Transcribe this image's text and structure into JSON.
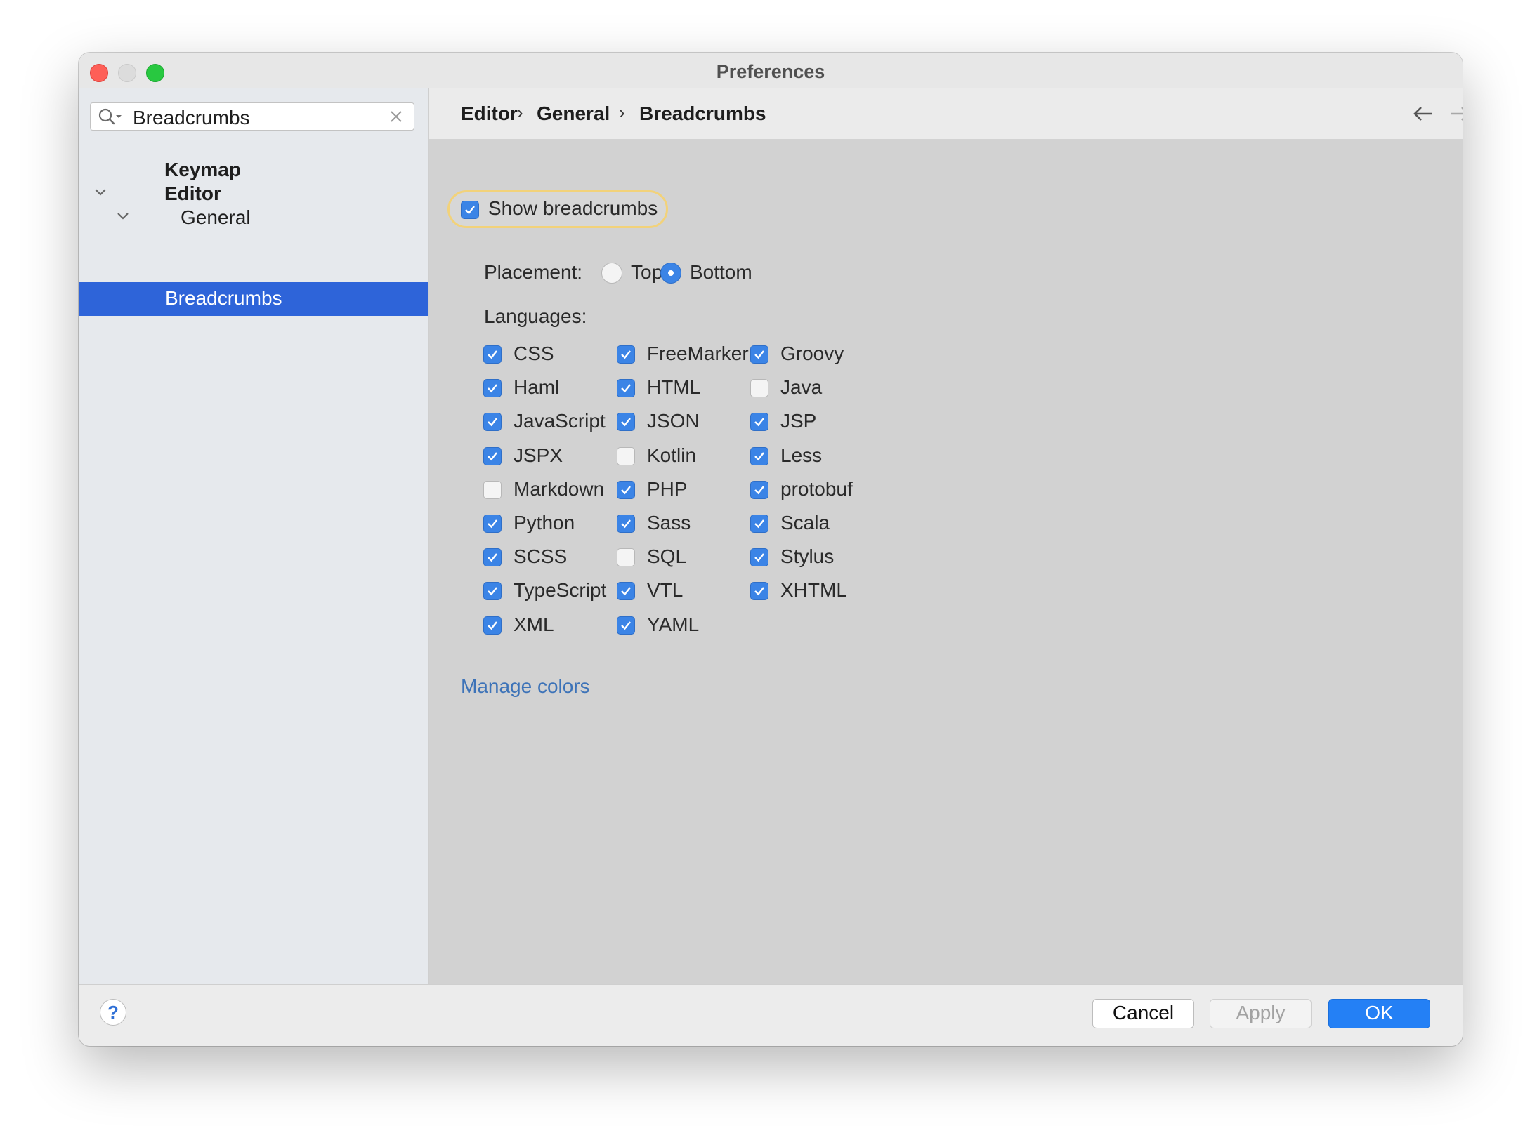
{
  "window": {
    "title": "Preferences"
  },
  "sidebar": {
    "search": {
      "value": "Breadcrumbs",
      "placeholder": ""
    },
    "items": [
      {
        "label": "Keymap"
      },
      {
        "label": "Editor"
      },
      {
        "label": "General"
      },
      {
        "label": "Breadcrumbs",
        "selected": true
      }
    ]
  },
  "breadcrumb": [
    "Editor",
    "General",
    "Breadcrumbs"
  ],
  "settings": {
    "show_breadcrumbs": {
      "label": "Show breadcrumbs",
      "checked": true
    },
    "placement": {
      "label": "Placement:",
      "options": [
        {
          "label": "Top",
          "selected": false
        },
        {
          "label": "Bottom",
          "selected": true
        }
      ]
    },
    "languages_label": "Languages:",
    "languages": [
      {
        "name": "CSS",
        "checked": true
      },
      {
        "name": "FreeMarker",
        "checked": true
      },
      {
        "name": "Groovy",
        "checked": true
      },
      {
        "name": "Haml",
        "checked": true
      },
      {
        "name": "HTML",
        "checked": true
      },
      {
        "name": "Java",
        "checked": false
      },
      {
        "name": "JavaScript",
        "checked": true
      },
      {
        "name": "JSON",
        "checked": true
      },
      {
        "name": "JSP",
        "checked": true
      },
      {
        "name": "JSPX",
        "checked": true
      },
      {
        "name": "Kotlin",
        "checked": false
      },
      {
        "name": "Less",
        "checked": true
      },
      {
        "name": "Markdown",
        "checked": false
      },
      {
        "name": "PHP",
        "checked": true
      },
      {
        "name": "protobuf",
        "checked": true
      },
      {
        "name": "Python",
        "checked": true
      },
      {
        "name": "Sass",
        "checked": true
      },
      {
        "name": "Scala",
        "checked": true
      },
      {
        "name": "SCSS",
        "checked": true
      },
      {
        "name": "SQL",
        "checked": false
      },
      {
        "name": "Stylus",
        "checked": true
      },
      {
        "name": "TypeScript",
        "checked": true
      },
      {
        "name": "VTL",
        "checked": true
      },
      {
        "name": "XHTML",
        "checked": true
      },
      {
        "name": "XML",
        "checked": true
      },
      {
        "name": "YAML",
        "checked": true
      }
    ],
    "manage_colors": "Manage colors"
  },
  "footer": {
    "help": "?",
    "cancel": "Cancel",
    "apply": "Apply",
    "ok": "OK"
  },
  "colors": {
    "accent": "#2e64d9",
    "checkbox": "#3b84e6",
    "ok_button": "#2480f5",
    "link": "#3d73b8",
    "focus_ring": "#f2d27a"
  }
}
